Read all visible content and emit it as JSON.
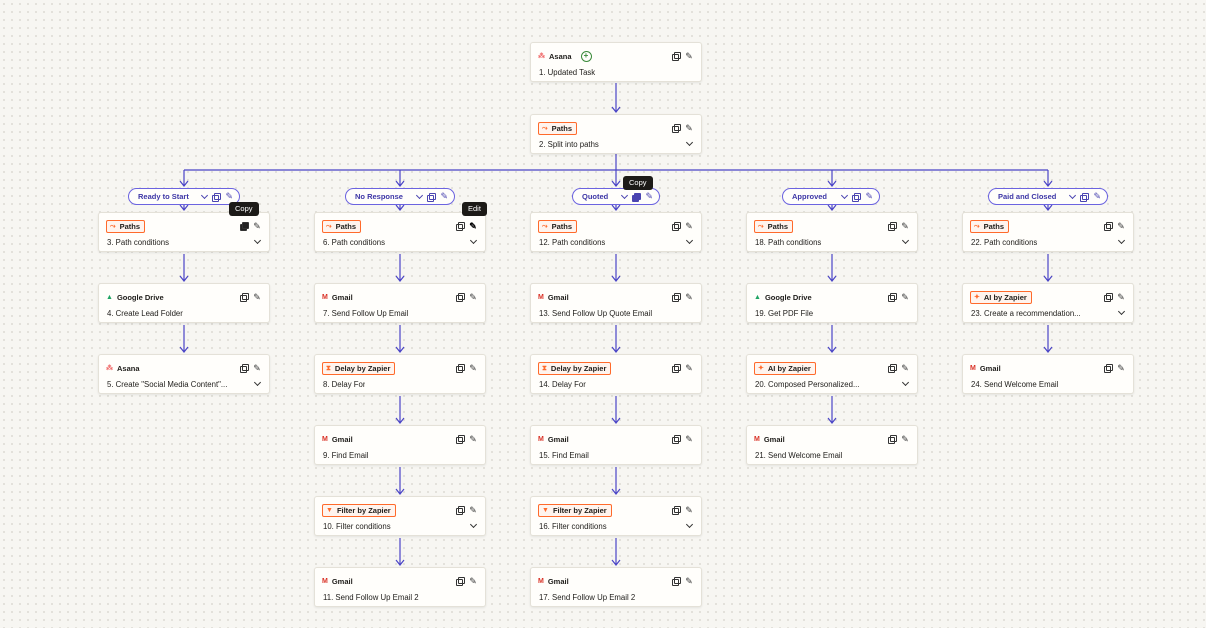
{
  "colors": {
    "accent": "#3d36a6",
    "connector": "#4a44c6",
    "badge_border": "#ff6a2b"
  },
  "steps": [
    {
      "id": "s1",
      "app": "Asana",
      "icon": "asana-icon",
      "title": "1. Updated Task",
      "chevron": false,
      "style": "plain",
      "plus": true
    },
    {
      "id": "s2",
      "app": "Paths",
      "icon": "paths-icon",
      "title": "2. Split into paths",
      "chevron": true,
      "style": "orange"
    },
    {
      "id": "s3",
      "app": "Paths",
      "icon": "paths-icon",
      "title": "3. Path conditions",
      "chevron": true,
      "style": "orange",
      "copy_active": true
    },
    {
      "id": "s4",
      "app": "Google Drive",
      "icon": "google-drive-icon",
      "title": "4. Create Lead Folder",
      "chevron": false,
      "style": "plain"
    },
    {
      "id": "s5",
      "app": "Asana",
      "icon": "asana-icon",
      "title": "5. Create \"Social Media Content\"...",
      "chevron": true,
      "style": "plain"
    },
    {
      "id": "s6",
      "app": "Paths",
      "icon": "paths-icon",
      "title": "6. Path conditions",
      "chevron": true,
      "style": "orange",
      "edit_active": true
    },
    {
      "id": "s7",
      "app": "Gmail",
      "icon": "gmail-icon",
      "title": "7. Send Follow Up Email",
      "chevron": false,
      "style": "plain"
    },
    {
      "id": "s8",
      "app": "Delay by Zapier",
      "icon": "delay-icon",
      "title": "8. Delay For",
      "chevron": false,
      "style": "orange"
    },
    {
      "id": "s9",
      "app": "Gmail",
      "icon": "gmail-icon",
      "title": "9. Find Email",
      "chevron": false,
      "style": "plain"
    },
    {
      "id": "s10",
      "app": "Filter by Zapier",
      "icon": "filter-icon",
      "title": "10. Filter conditions",
      "chevron": true,
      "style": "orange"
    },
    {
      "id": "s11",
      "app": "Gmail",
      "icon": "gmail-icon",
      "title": "11. Send Follow Up Email 2",
      "chevron": false,
      "style": "plain"
    },
    {
      "id": "s12",
      "app": "Paths",
      "icon": "paths-icon",
      "title": "12. Path conditions",
      "chevron": true,
      "style": "orange"
    },
    {
      "id": "s13",
      "app": "Gmail",
      "icon": "gmail-icon",
      "title": "13. Send Follow Up Quote Email",
      "chevron": false,
      "style": "plain"
    },
    {
      "id": "s14",
      "app": "Delay by Zapier",
      "icon": "delay-icon",
      "title": "14. Delay For",
      "chevron": false,
      "style": "orange"
    },
    {
      "id": "s15",
      "app": "Gmail",
      "icon": "gmail-icon",
      "title": "15. Find Email",
      "chevron": false,
      "style": "plain"
    },
    {
      "id": "s16",
      "app": "Filter by Zapier",
      "icon": "filter-icon",
      "title": "16. Filter conditions",
      "chevron": true,
      "style": "orange"
    },
    {
      "id": "s17",
      "app": "Gmail",
      "icon": "gmail-icon",
      "title": "17. Send Follow Up Email 2",
      "chevron": false,
      "style": "plain"
    },
    {
      "id": "s18",
      "app": "Paths",
      "icon": "paths-icon",
      "title": "18. Path conditions",
      "chevron": true,
      "style": "orange"
    },
    {
      "id": "s19",
      "app": "Google Drive",
      "icon": "google-drive-icon",
      "title": "19. Get PDF File",
      "chevron": false,
      "style": "plain"
    },
    {
      "id": "s20",
      "app": "AI by Zapier",
      "icon": "ai-icon",
      "title": "20. Composed Personalized...",
      "chevron": true,
      "style": "orange"
    },
    {
      "id": "s21",
      "app": "Gmail",
      "icon": "gmail-icon",
      "title": "21. Send Welcome Email",
      "chevron": false,
      "style": "plain"
    },
    {
      "id": "s22",
      "app": "Paths",
      "icon": "paths-icon",
      "title": "22. Path conditions",
      "chevron": true,
      "style": "orange"
    },
    {
      "id": "s23",
      "app": "AI by Zapier",
      "icon": "ai-icon",
      "title": "23. Create a recommendation...",
      "chevron": true,
      "style": "orange"
    },
    {
      "id": "s24",
      "app": "Gmail",
      "icon": "gmail-icon",
      "title": "24. Send Welcome Email",
      "chevron": false,
      "style": "plain"
    }
  ],
  "paths": [
    {
      "id": "p1",
      "label": "Ready to Start"
    },
    {
      "id": "p2",
      "label": "No Response"
    },
    {
      "id": "p3",
      "label": "Quoted",
      "copy_active": true
    },
    {
      "id": "p4",
      "label": "Approved"
    },
    {
      "id": "p5",
      "label": "Paid and Closed"
    }
  ],
  "tooltips": {
    "copy_step": "Copy",
    "edit_step": "Edit",
    "copy_path": "Copy"
  }
}
